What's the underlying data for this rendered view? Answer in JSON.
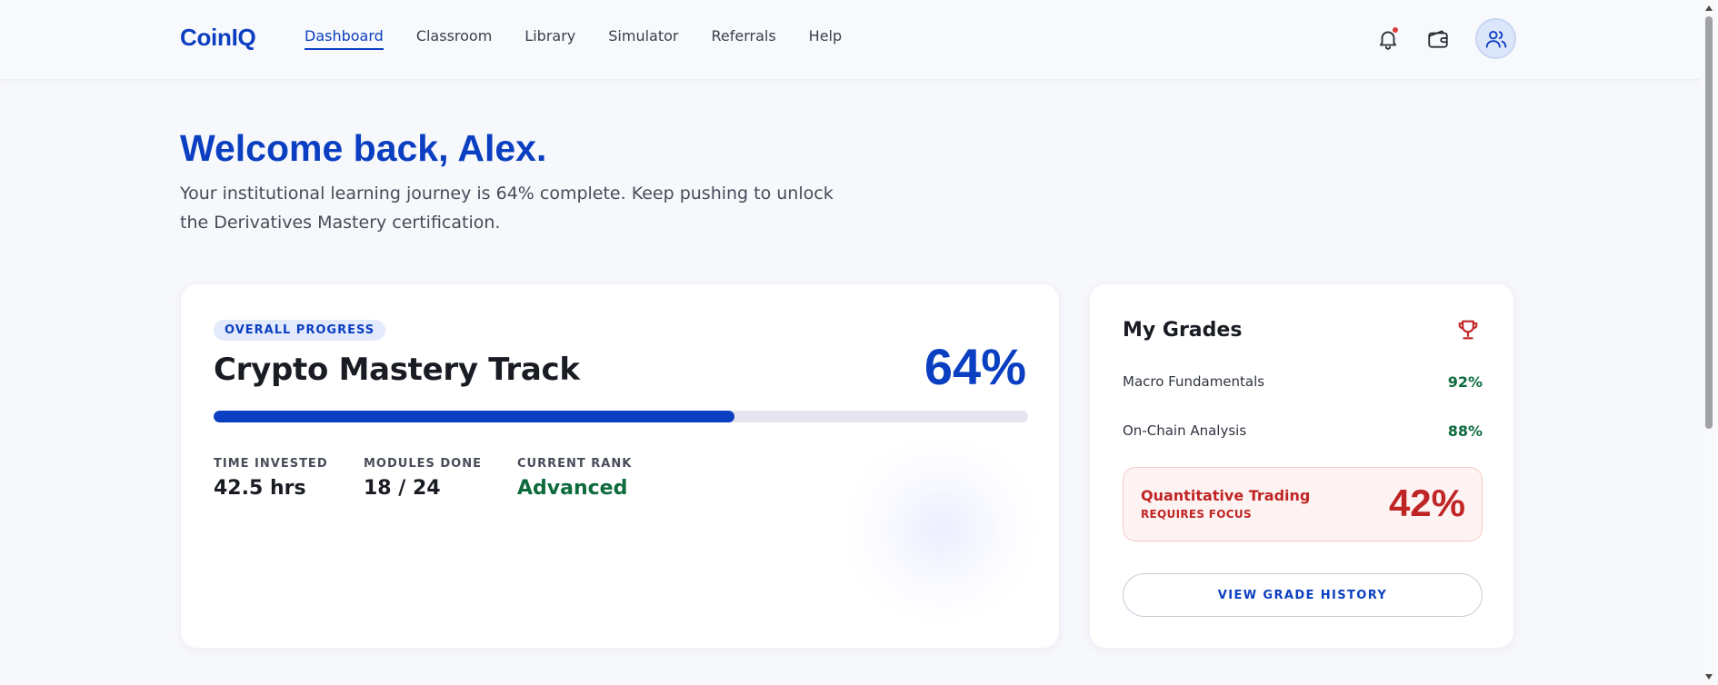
{
  "brand": "CoinIQ",
  "nav": {
    "items": [
      {
        "label": "Dashboard",
        "active": true
      },
      {
        "label": "Classroom",
        "active": false
      },
      {
        "label": "Library",
        "active": false
      },
      {
        "label": "Simulator",
        "active": false
      },
      {
        "label": "Referrals",
        "active": false
      },
      {
        "label": "Help",
        "active": false
      }
    ]
  },
  "header_icons": {
    "notifications": "bell-icon",
    "wallet": "wallet-icon",
    "profile": "users-icon"
  },
  "welcome": {
    "title": "Welcome back, Alex.",
    "subtitle": "Your institutional learning journey is 64% complete. Keep pushing to unlock the Derivatives Mastery certification."
  },
  "progress": {
    "badge": "OVERALL PROGRESS",
    "title": "Crypto Mastery Track",
    "percent_label": "64%",
    "percent_value": 0.64,
    "stats": [
      {
        "label": "TIME INVESTED",
        "value": "42.5 hrs"
      },
      {
        "label": "MODULES DONE",
        "value": "18 / 24"
      },
      {
        "label": "CURRENT RANK",
        "value": "Advanced"
      }
    ]
  },
  "grades": {
    "title": "My Grades",
    "icon": "trophy-icon",
    "items": [
      {
        "name": "Macro Fundamentals",
        "value": "92%"
      },
      {
        "name": "On-Chain Analysis",
        "value": "88%"
      }
    ],
    "focus": {
      "name": "Quantitative Trading",
      "tag": "REQUIRES FOCUS",
      "value": "42%"
    },
    "history_button": "VIEW GRADE HISTORY"
  },
  "colors": {
    "accent": "#0b3fc1",
    "success": "#0d6b3e",
    "danger": "#c02525"
  }
}
